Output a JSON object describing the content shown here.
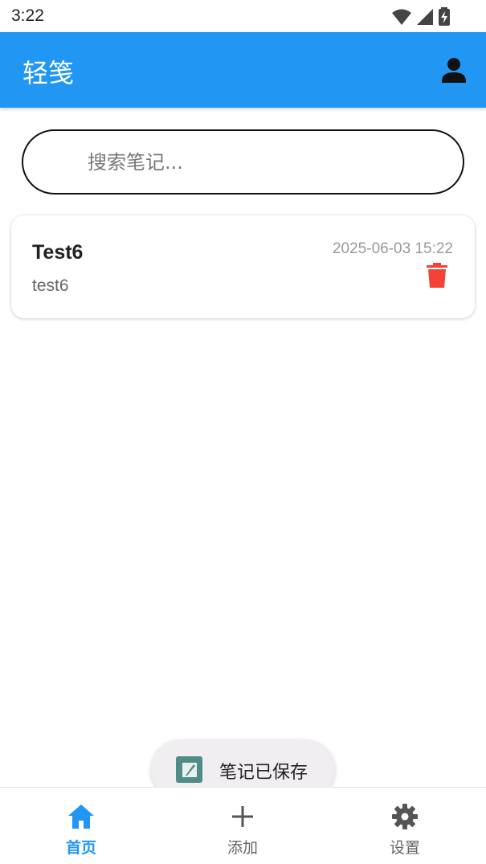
{
  "status_bar": {
    "time": "3:22",
    "icons": [
      "wifi-icon",
      "signal-icon",
      "battery-charging-icon"
    ]
  },
  "app_bar": {
    "title": "轻笺",
    "profile_icon": "person-icon"
  },
  "search": {
    "placeholder": "搜索笔记...",
    "value": ""
  },
  "notes": [
    {
      "title": "Test6",
      "body": "test6",
      "date": "2025-06-03 15:22",
      "delete_icon": "trash-icon"
    }
  ],
  "toast": {
    "text": "笔记已保存",
    "icon": "app-logo-icon"
  },
  "bottom_nav": {
    "items": [
      {
        "label": "首页",
        "icon": "home-icon",
        "active": true
      },
      {
        "label": "添加",
        "icon": "plus-icon",
        "active": false
      },
      {
        "label": "设置",
        "icon": "gear-icon",
        "active": false
      }
    ]
  },
  "colors": {
    "primary": "#2196f3",
    "delete": "#f44336",
    "toast_bg": "#f1eef2"
  }
}
